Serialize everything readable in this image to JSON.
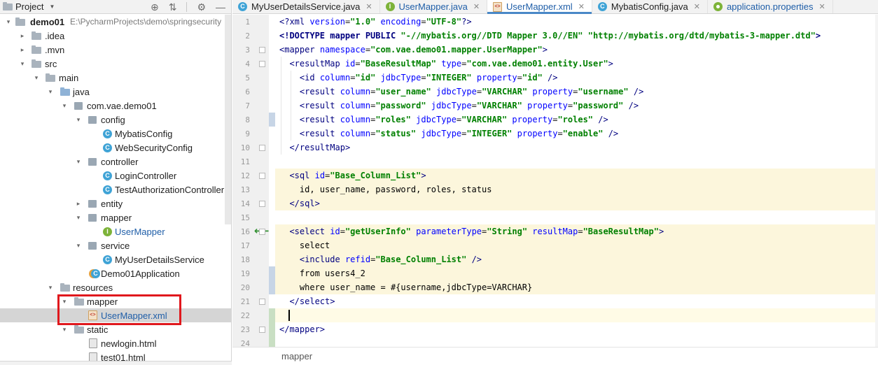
{
  "project_panel": {
    "title": "Project",
    "tools": {
      "locate": "⊕",
      "collapse": "⇅",
      "settings": "⚙",
      "hide": "—"
    },
    "tree": [
      {
        "key": "demo01",
        "label": "demo01",
        "extra": "E:\\PycharmProjects\\demo\\springsecurity",
        "icon": "folder-icon",
        "arrow": "▾"
      },
      {
        "key": "idea",
        "label": ".idea",
        "icon": "folder-icon",
        "arrow": "▸"
      },
      {
        "key": "mvn",
        "label": ".mvn",
        "icon": "folder-icon",
        "arrow": "▸"
      },
      {
        "key": "src",
        "label": "src",
        "icon": "folder-icon",
        "arrow": "▾"
      },
      {
        "key": "main",
        "label": "main",
        "icon": "folder-icon",
        "arrow": "▾"
      },
      {
        "key": "java",
        "label": "java",
        "icon": "source-folder-icon",
        "arrow": "▾"
      },
      {
        "key": "pkg",
        "label": "com.vae.demo01",
        "icon": "package-icon",
        "arrow": "▾"
      },
      {
        "key": "config",
        "label": "config",
        "icon": "package-icon",
        "arrow": "▾"
      },
      {
        "key": "mybatisconfig",
        "label": "MybatisConfig",
        "icon": "class-icon"
      },
      {
        "key": "websecurityconfig",
        "label": "WebSecurityConfig",
        "icon": "class-icon"
      },
      {
        "key": "controller",
        "label": "controller",
        "icon": "package-icon",
        "arrow": "▾"
      },
      {
        "key": "logincontroller",
        "label": "LoginController",
        "icon": "class-icon"
      },
      {
        "key": "testauth",
        "label": "TestAuthorizationController",
        "icon": "class-icon"
      },
      {
        "key": "entity",
        "label": "entity",
        "icon": "package-icon",
        "arrow": "▸"
      },
      {
        "key": "mapper",
        "label": "mapper",
        "icon": "package-icon",
        "arrow": "▾"
      },
      {
        "key": "usermapper",
        "label": "UserMapper",
        "icon": "interface-icon"
      },
      {
        "key": "service",
        "label": "service",
        "icon": "package-icon",
        "arrow": "▾"
      },
      {
        "key": "myuserdetailsservice",
        "label": "MyUserDetailsService",
        "icon": "class-icon"
      },
      {
        "key": "demo01app",
        "label": "Demo01Application",
        "icon": "spring-app-icon"
      },
      {
        "key": "resources",
        "label": "resources",
        "icon": "resources-folder-icon",
        "arrow": "▾"
      },
      {
        "key": "mapperdir",
        "label": "mapper",
        "icon": "folder-icon",
        "arrow": "▾"
      },
      {
        "key": "usermapperxml",
        "label": "UserMapper.xml",
        "icon": "xml-file-icon"
      },
      {
        "key": "static",
        "label": "static",
        "icon": "folder-icon",
        "arrow": "▾"
      },
      {
        "key": "newlogin",
        "label": "newlogin.html",
        "icon": "html-file-icon"
      },
      {
        "key": "test01",
        "label": "test01.html",
        "icon": "html-file-icon"
      }
    ]
  },
  "tabs": [
    {
      "label": "MyUserDetailsService.java",
      "icon": "class-icon"
    },
    {
      "label": "UserMapper.java",
      "icon": "interface-icon"
    },
    {
      "label": "UserMapper.xml",
      "icon": "xml-file-icon"
    },
    {
      "label": "MybatisConfig.java",
      "icon": "class-icon"
    },
    {
      "label": "application.properties",
      "icon": "properties-icon"
    }
  ],
  "editor": {
    "line_numbers": [
      "1",
      "2",
      "3",
      "4",
      "5",
      "6",
      "7",
      "8",
      "9",
      "10",
      "11",
      "12",
      "13",
      "14",
      "15",
      "16",
      "17",
      "18",
      "19",
      "20",
      "21",
      "22",
      "23",
      "24"
    ],
    "lines": [
      "<?xml version=\"1.0\" encoding=\"UTF-8\"?>",
      "<!DOCTYPE mapper PUBLIC \"-//mybatis.org//DTD Mapper 3.0//EN\" \"http://mybatis.org/dtd/mybatis-3-mapper.dtd\">",
      "<mapper namespace=\"com.vae.demo01.mapper.UserMapper\">",
      "  <resultMap id=\"BaseResultMap\" type=\"com.vae.demo01.entity.User\">",
      "    <id column=\"id\" jdbcType=\"INTEGER\" property=\"id\" />",
      "    <result column=\"user_name\" jdbcType=\"VARCHAR\" property=\"username\" />",
      "    <result column=\"password\" jdbcType=\"VARCHAR\" property=\"password\" />",
      "    <result column=\"roles\" jdbcType=\"VARCHAR\" property=\"roles\" />",
      "    <result column=\"status\" jdbcType=\"INTEGER\" property=\"enable\" />",
      "  </resultMap>",
      "",
      "  <sql id=\"Base_Column_List\">",
      "    id, user_name, password, roles, status",
      "  </sql>",
      "",
      "  <select id=\"getUserInfo\" parameterType=\"String\" resultMap=\"BaseResultMap\">",
      "    select",
      "    <include refid=\"Base_Column_List\" />",
      "    from users4_2",
      "    where user_name = #{username,jdbcType=VARCHAR}",
      "  </select>",
      "",
      "</mapper>",
      ""
    ],
    "breadcrumb": "mapper"
  },
  "colors": {
    "tag": "#000080",
    "attr": "#0000ff",
    "string": "#008000",
    "selection_box": "#e0181d",
    "active_tab_underline": "#4a88c7",
    "sql_highlight": "#fcf6dc"
  }
}
